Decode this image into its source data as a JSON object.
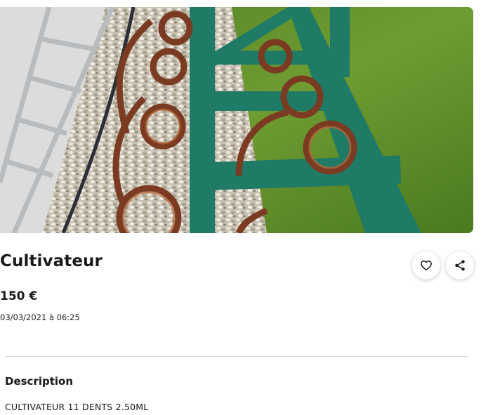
{
  "listing": {
    "title": "Cultivateur",
    "price": "150 €",
    "date": "03/03/2021 à 06:25"
  },
  "actions": {
    "favorite_icon": "heart-icon",
    "share_icon": "share-icon"
  },
  "description": {
    "heading": "Description",
    "body": "CULTIVATEUR 11 DENTS 2.50ML"
  },
  "colors": {
    "frame": "#1f7a66",
    "tines": "#7a3b22",
    "grass": "#5f8f2c"
  }
}
